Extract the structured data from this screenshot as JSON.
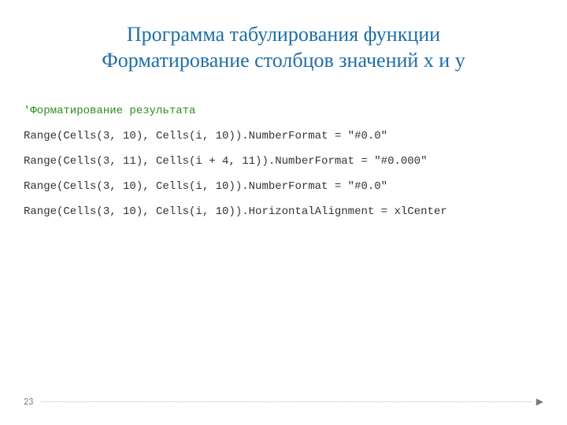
{
  "title": {
    "line1": "Программа табулирования функции",
    "line2": "Форматирование столбцов значений x и y"
  },
  "code": {
    "comment": "'Форматирование результата",
    "lines": [
      "Range(Cells(3, 10), Cells(i, 10)).NumberFormat = \"#0.0\"",
      "Range(Cells(3, 11), Cells(i + 4, 11)).NumberFormat = \"#0.000\"",
      "Range(Cells(3, 10), Cells(i, 10)).NumberFormat = \"#0.0\"",
      "Range(Cells(3, 10), Cells(i, 10)).HorizontalAlignment = xlCenter"
    ]
  },
  "footer": {
    "page": "23",
    "arrow": "▶"
  }
}
